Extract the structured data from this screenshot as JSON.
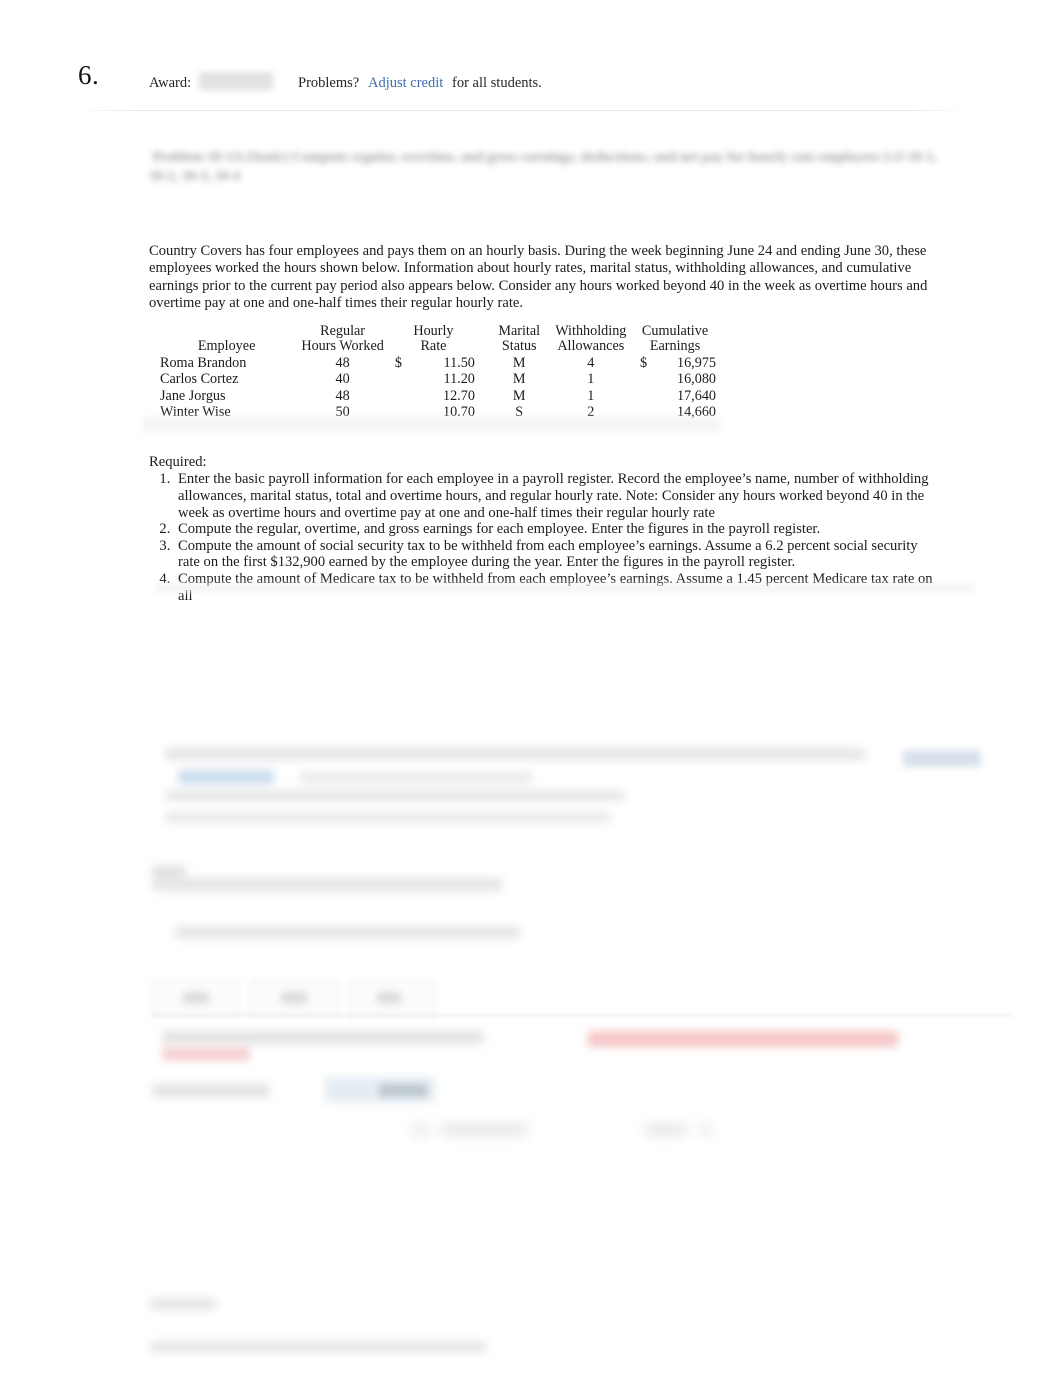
{
  "header": {
    "question_number": "6.",
    "award_label": "Award:",
    "award_value": "",
    "problems_label": "Problems?",
    "adjust_credit_link": "Adjust credit",
    "for_all_students": "for all students."
  },
  "intro_heading": "",
  "problem": {
    "paragraph": "Country Covers has four employees and pays them on an hourly basis. During the week beginning June 24 and ending June 30, these employees worked the hours shown below. Information about hourly rates, marital status, withholding allowances, and cumulative earnings prior to the current pay period also appears below. Consider any hours worked beyond 40 in the week as overtime hours and overtime pay at one and one-half times their regular hourly rate."
  },
  "table": {
    "headers": {
      "employee": "Employee",
      "regular_hours_worked": [
        "Regular",
        "Hours Worked"
      ],
      "hourly_rate": [
        "Hourly",
        "Rate"
      ],
      "marital_status": [
        "Marital",
        "Status"
      ],
      "withholding_allowances": [
        "Withholding",
        "Allowances"
      ],
      "cumulative_earnings": [
        "Cumulative",
        "Earnings"
      ]
    },
    "currency_symbol": "$",
    "rows": [
      {
        "employee": "Roma Brandon",
        "regular_hours_worked": "48",
        "rate_currency": "$",
        "hourly_rate": "11.50",
        "marital_status": "M",
        "withholding_allowances": "4",
        "earnings_currency": "$",
        "cumulative_earnings": "16,975"
      },
      {
        "employee": "Carlos Cortez",
        "regular_hours_worked": "40",
        "rate_currency": "",
        "hourly_rate": "11.20",
        "marital_status": "M",
        "withholding_allowances": "1",
        "earnings_currency": "",
        "cumulative_earnings": "16,080"
      },
      {
        "employee": "Jane Jorgus",
        "regular_hours_worked": "48",
        "rate_currency": "",
        "hourly_rate": "12.70",
        "marital_status": "M",
        "withholding_allowances": "1",
        "earnings_currency": "",
        "cumulative_earnings": "17,640"
      },
      {
        "employee": "Winter Wise",
        "regular_hours_worked": "50",
        "rate_currency": "",
        "hourly_rate": "10.70",
        "marital_status": "S",
        "withholding_allowances": "2",
        "earnings_currency": "",
        "cumulative_earnings": "14,660"
      }
    ]
  },
  "required": {
    "label": "Required:",
    "items": [
      "Enter the basic payroll information for each employee in a payroll register. Record the employee’s name, number of withholding allowances, marital status, total and overtime hours, and regular hourly rate. Note: Consider any hours worked beyond 40 in the week as overtime hours and overtime pay at one and one-half times their regular hourly rate",
      "Compute the regular, overtime, and gross earnings for each employee. Enter the figures in the payroll register.",
      "Compute the amount of social security tax to be withheld from each employee’s earnings. Assume a 6.2 percent social security rate on the first $132,900 earned by the employee during the year. Enter the figures in the payroll register.",
      "Compute the amount of Medicare tax to be withheld from each employee’s earnings. Assume a 1.45 percent Medicare tax rate on all"
    ]
  },
  "lower_area": {
    "note": "obscured",
    "tabs": [
      "",
      "",
      ""
    ],
    "badge": "",
    "error_banner": "",
    "row_label": "",
    "row_input_value": "",
    "explanation_label": "",
    "explanation_text": ""
  },
  "colors": {
    "link": "#3c6db0",
    "text": "#1c1c1c",
    "page_background": "#ffffff",
    "error": "#f2b6b6",
    "highlight": "#f4c9c9",
    "badge": "#c7d4e4"
  }
}
